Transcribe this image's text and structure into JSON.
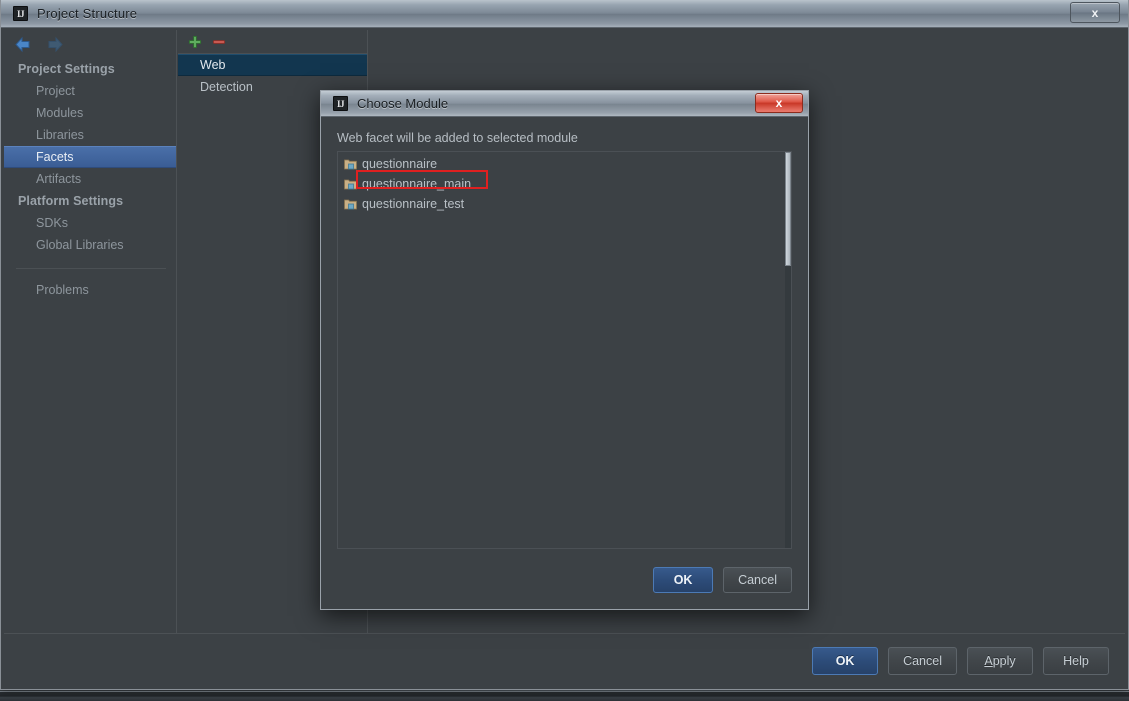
{
  "main_window": {
    "title": "Project Structure",
    "icon": "intellij-idea-icon",
    "icon_text": "IJ",
    "close_label": "x"
  },
  "nav_toolbar": {
    "back_icon": "back-arrow-icon",
    "forward_icon": "forward-arrow-icon"
  },
  "sidebar": {
    "groups": [
      {
        "label": "Project Settings",
        "items": [
          {
            "label": "Project",
            "selected": false
          },
          {
            "label": "Modules",
            "selected": false
          },
          {
            "label": "Libraries",
            "selected": false
          },
          {
            "label": "Facets",
            "selected": true
          },
          {
            "label": "Artifacts",
            "selected": false
          }
        ]
      },
      {
        "label": "Platform Settings",
        "items": [
          {
            "label": "SDKs",
            "selected": false
          },
          {
            "label": "Global Libraries",
            "selected": false
          }
        ]
      }
    ],
    "problems_label": "Problems"
  },
  "facet_panel": {
    "add_icon": "plus-icon",
    "remove_icon": "minus-icon",
    "rows": [
      {
        "label": "Web",
        "selected": true
      },
      {
        "label": "Detection",
        "selected": false
      }
    ]
  },
  "bottom_bar": {
    "buttons": [
      {
        "label": "OK",
        "primary": true,
        "mnemonic": ""
      },
      {
        "label": "Cancel",
        "primary": false,
        "mnemonic": ""
      },
      {
        "label": "Apply",
        "primary": false,
        "mnemonic": "A"
      },
      {
        "label": "Help",
        "primary": false,
        "mnemonic": ""
      }
    ]
  },
  "dialog": {
    "title": "Choose Module",
    "icon": "intellij-idea-icon",
    "icon_text": "IJ",
    "close_label": "x",
    "prompt": "Web facet will be added to selected module",
    "modules": [
      {
        "label": "questionnaire",
        "icon": "module-folder-icon",
        "highlighted": false
      },
      {
        "label": "questionnaire_main",
        "icon": "module-folder-icon",
        "highlighted": true
      },
      {
        "label": "questionnaire_test",
        "icon": "module-folder-icon",
        "highlighted": false
      }
    ],
    "highlight_color": "#e02020",
    "buttons": [
      {
        "label": "OK",
        "primary": true
      },
      {
        "label": "Cancel",
        "primary": false
      }
    ],
    "scrollbar": {
      "visible": true
    }
  },
  "theme": {
    "accent_selected": "#3a5d95",
    "list_selected": "#12364f",
    "background": "#3c4145",
    "text": "#b9c0c6"
  }
}
